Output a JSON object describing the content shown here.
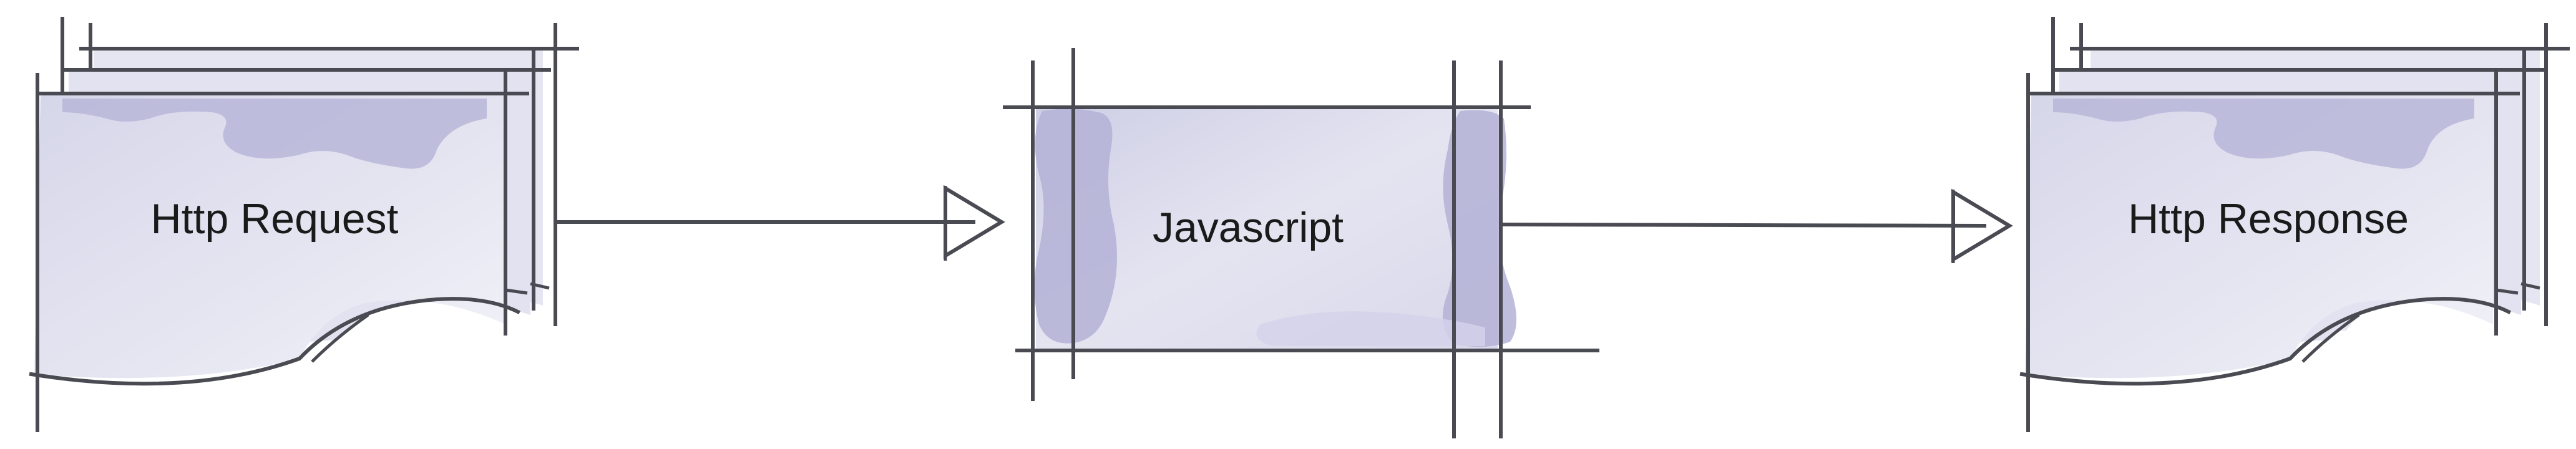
{
  "diagram": {
    "nodes": [
      {
        "id": "request",
        "label": "Http Request",
        "shape": "document-stack"
      },
      {
        "id": "script",
        "label": "Javascript",
        "shape": "sketched-box"
      },
      {
        "id": "response",
        "label": "Http Response",
        "shape": "document-stack"
      }
    ],
    "edges": [
      {
        "from": "request",
        "to": "script",
        "arrowhead": "hollow-triangle"
      },
      {
        "from": "script",
        "to": "response",
        "arrowhead": "hollow-triangle"
      }
    ],
    "colors": {
      "fill_light": "#eaeaf4",
      "fill_mid": "#d2d2e8",
      "shadow": "#b4b2d6",
      "line": "#4a4a52",
      "text": "#1a1a1a"
    }
  }
}
